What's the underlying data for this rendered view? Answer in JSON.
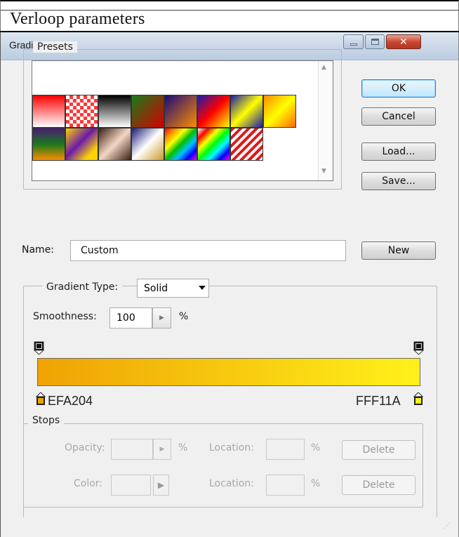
{
  "caption": "Verloop  parameters",
  "window": {
    "title": "Gradient Editor"
  },
  "presets": {
    "legend": "Presets",
    "swatches": [
      "linear-gradient(#ff0000, #ffffff)",
      "repeating-conic-gradient(#ff3a3a 0% 25%, #ffffff 0% 50%) 0 0/10px 10px",
      "linear-gradient(#000000, #ffffff)",
      "linear-gradient(135deg, #1a7a1a, #d40000)",
      "linear-gradient(135deg, #1a0a7a, #ff8c00)",
      "linear-gradient(135deg, #1a1aaa, #ff0000 50%, #ffff00)",
      "linear-gradient(135deg, #1a1aaa, #ffff00 50%, #1a1aaa)",
      "linear-gradient(135deg, #ff8a00, #ffff00 50%, #ff6a00)",
      "linear-gradient(#4a1a7a, #1a7a1a 50%, #ff8c00)",
      "linear-gradient(135deg, #ffd200, #6a1aaa 45%, #ffd200 80%)",
      "linear-gradient(135deg, #3a2010, #f4d6c4 50%, #3a2010)",
      "linear-gradient(135deg, #1a1a7a, #ffffff 50%, #c89a28)",
      "linear-gradient(135deg, #ff0000, #ff8c00, #ffff00, #00c000, #00c0ff, #0000ff, #ff00ff)",
      "linear-gradient(135deg, #ffffff, #ff0000, #ffff00, #00ff00, #00ffff, #0000ff, #ff00ff)",
      "repeating-linear-gradient(135deg, #e01818 0 4px, #ffffff 4px 8px)"
    ]
  },
  "buttons": {
    "ok": "OK",
    "cancel": "Cancel",
    "load": "Load...",
    "save": "Save...",
    "new": "New"
  },
  "name": {
    "label": "Name:",
    "value": "Custom"
  },
  "gradient": {
    "type_label": "Gradient Type:",
    "type_value": "Solid",
    "smoothness_label": "Smoothness:",
    "smoothness_value": "100",
    "smoothness_unit": "%",
    "bar": "linear-gradient(90deg, #efa204, #fff11a)",
    "left_stop_hex": "EFA204",
    "right_stop_hex": "FFF11A",
    "left_stop_color": "#efa204",
    "right_stop_color": "#fff11a"
  },
  "stops": {
    "legend": "Stops",
    "opacity_label": "Opacity:",
    "color_label": "Color:",
    "location_label": "Location:",
    "percent": "%",
    "delete_label": "Delete"
  }
}
